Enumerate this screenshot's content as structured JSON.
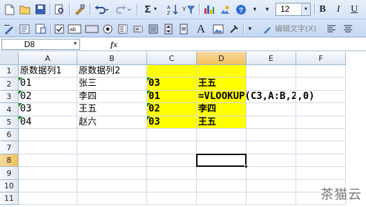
{
  "toolbar": {
    "font_size": "12",
    "bold_label": "B",
    "italic_label": "I",
    "underline_label": "U",
    "sum_label": "Σ",
    "edit_text_label": "编辑文字(X)"
  },
  "formula_bar": {
    "name_box": "D8",
    "fx_label": "fx",
    "formula": ""
  },
  "columns": [
    "A",
    "B",
    "C",
    "D",
    "E",
    "F"
  ],
  "selected_column": "D",
  "rows": [
    "1",
    "2",
    "3",
    "4",
    "5",
    "6",
    "7",
    "8",
    "9",
    "10",
    "11"
  ],
  "selected_row": "8",
  "cells": {
    "A1": "原数据列1",
    "B1": "原数据列2",
    "A2": "01",
    "B2": "张三",
    "C2": "03",
    "D2": "王五",
    "A3": "02",
    "B3": "李四",
    "C3": "01",
    "D3": "=VLOOKUP(C3,A:B,2,0)",
    "A4": "03",
    "B4": "王五",
    "C4": "02",
    "D4": "李四",
    "A5": "04",
    "B5": "赵六",
    "C5": "03",
    "D5": "王五"
  },
  "colors": {
    "highlight": "#ffff00",
    "header_selected": "#f1c05c",
    "error_indicator": "#008000"
  },
  "watermark": "茶猫云"
}
